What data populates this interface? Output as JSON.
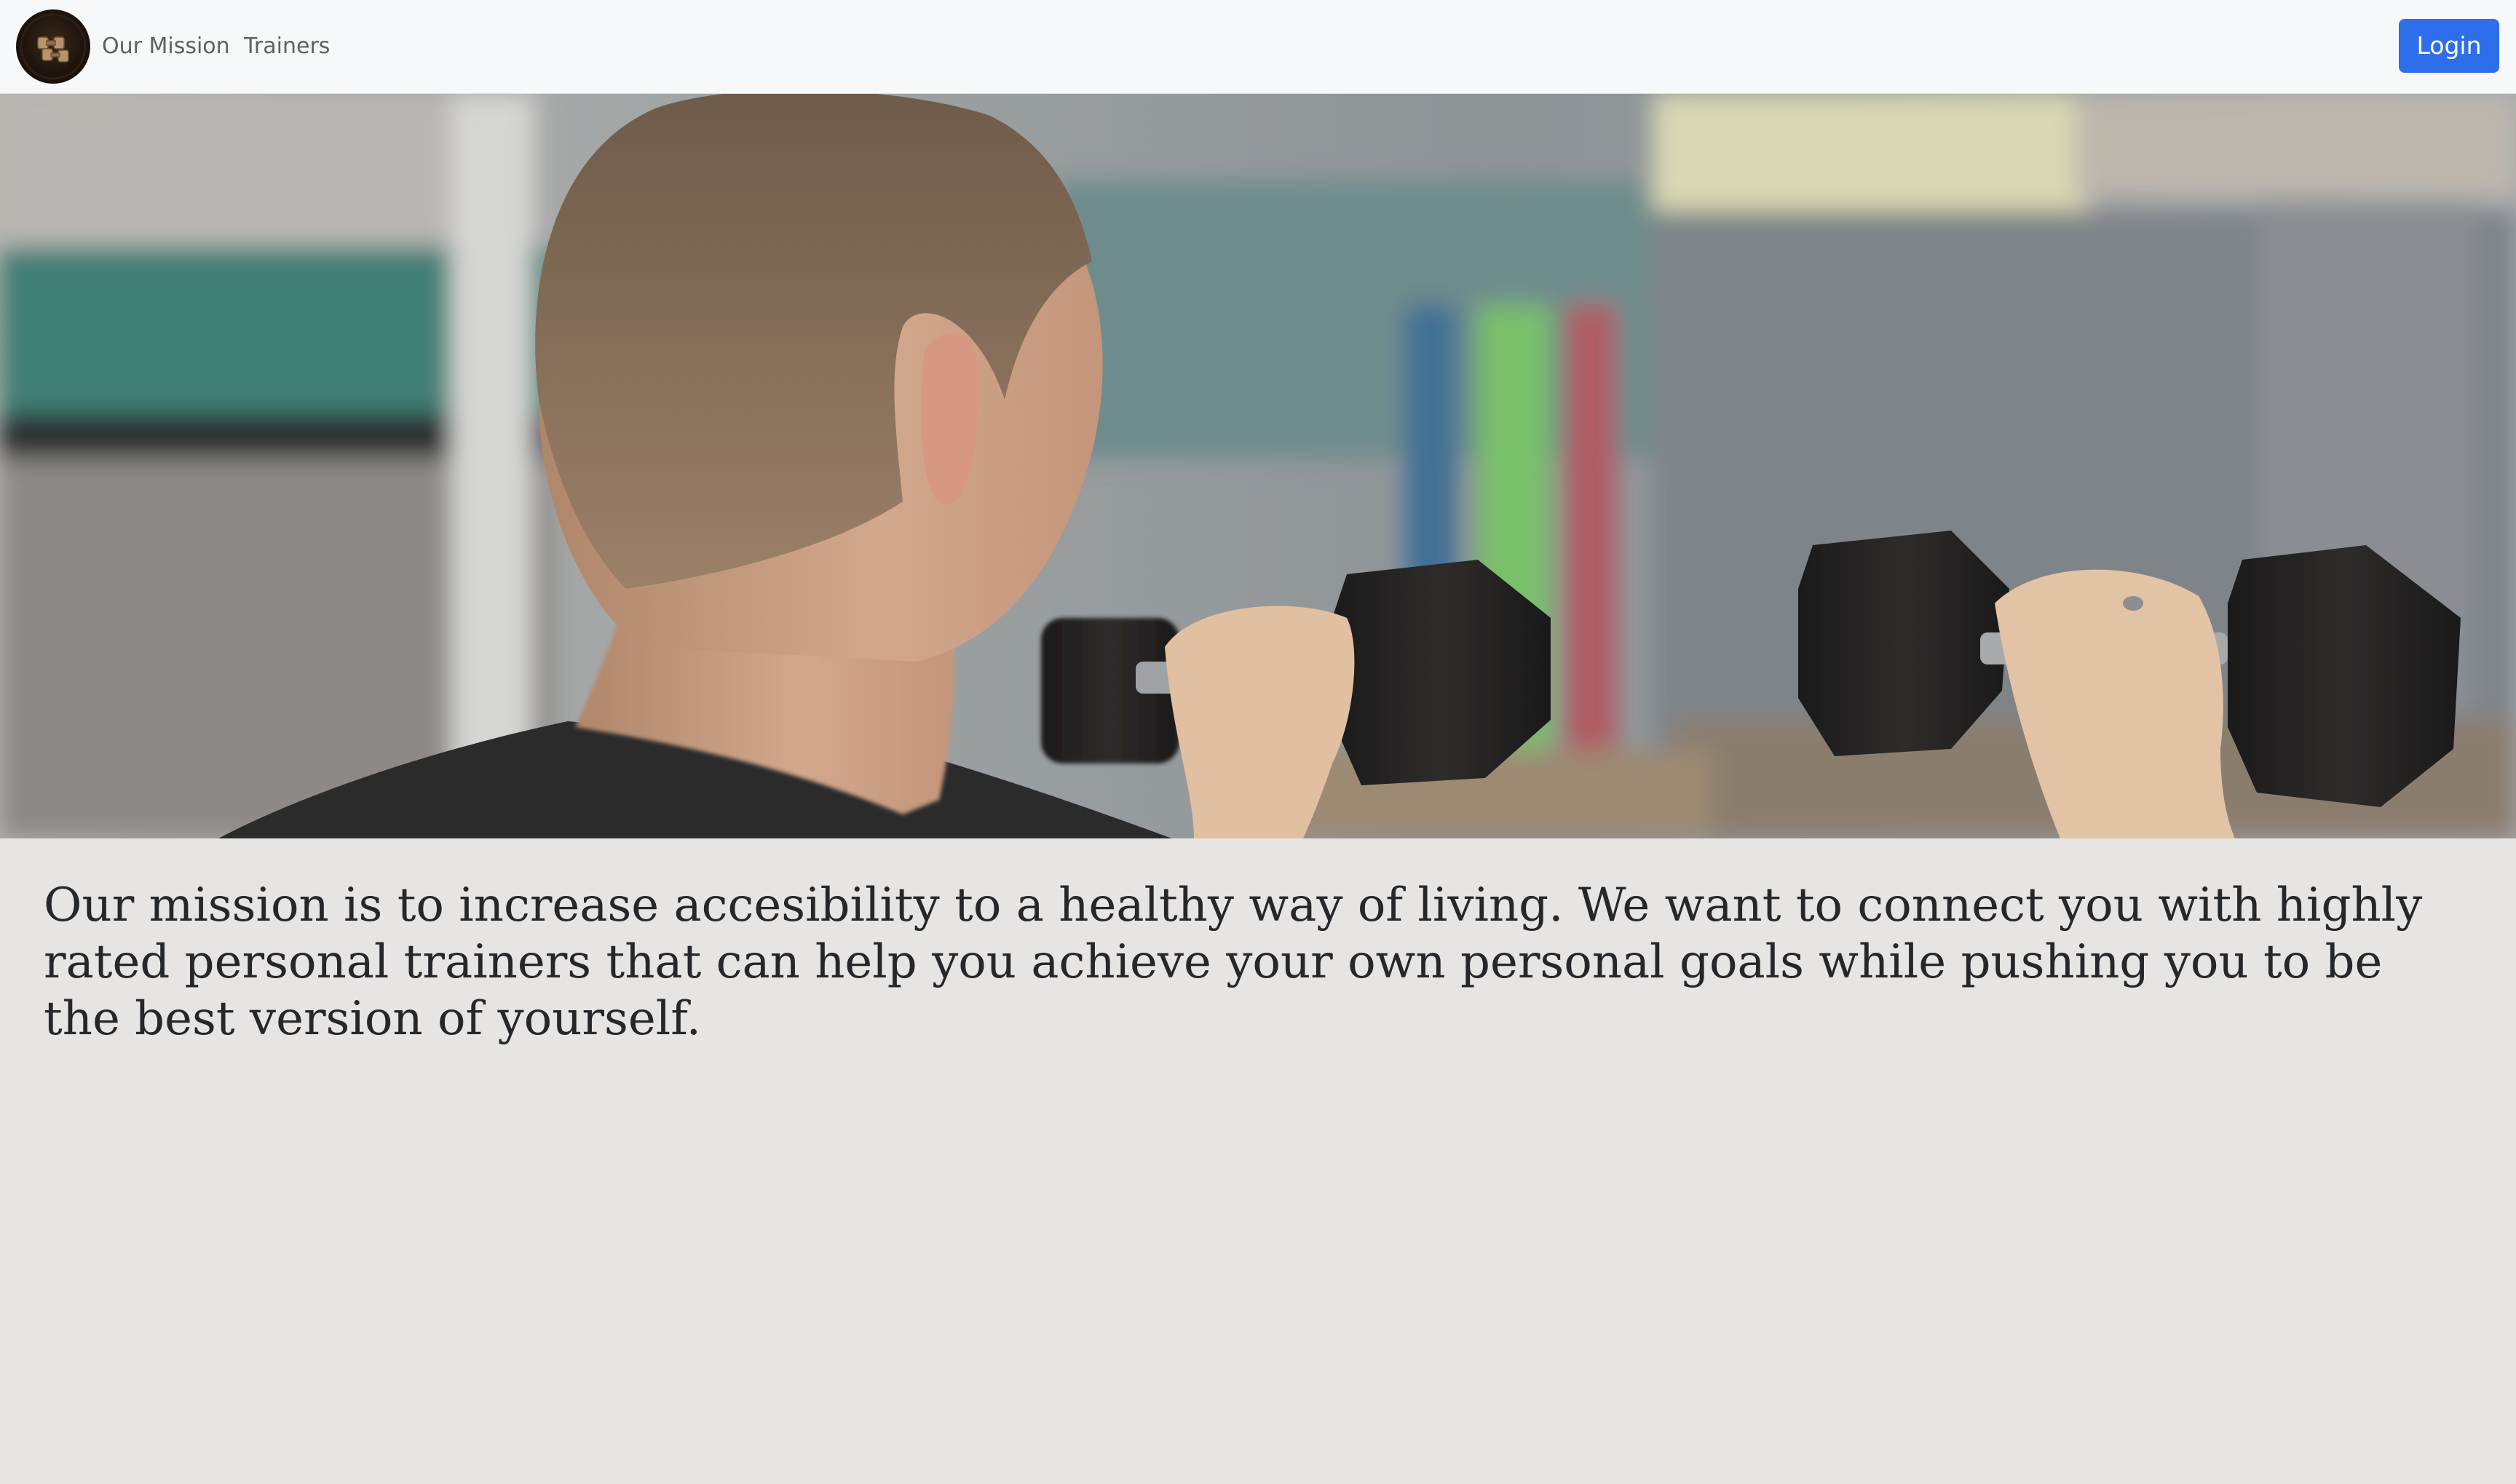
{
  "navbar": {
    "logo_icon": "dumbbell-logo-icon",
    "links": [
      {
        "label": "Our Mission"
      },
      {
        "label": "Trainers"
      }
    ],
    "login_label": "Login"
  },
  "hero": {
    "image": "man-lifting-dumbbells-photo"
  },
  "mission": {
    "text": "Our mission is to increase accesibility to a healthy way of living. We want to connect you with highly rated personal trainers that can help you achieve your own personal goals while pushing you to be the best version of yourself."
  },
  "colors": {
    "navbar_bg": "#f7f8fa",
    "page_bg": "#e6e5e3",
    "login_button": "#2f6eea",
    "text": "#26272a"
  }
}
